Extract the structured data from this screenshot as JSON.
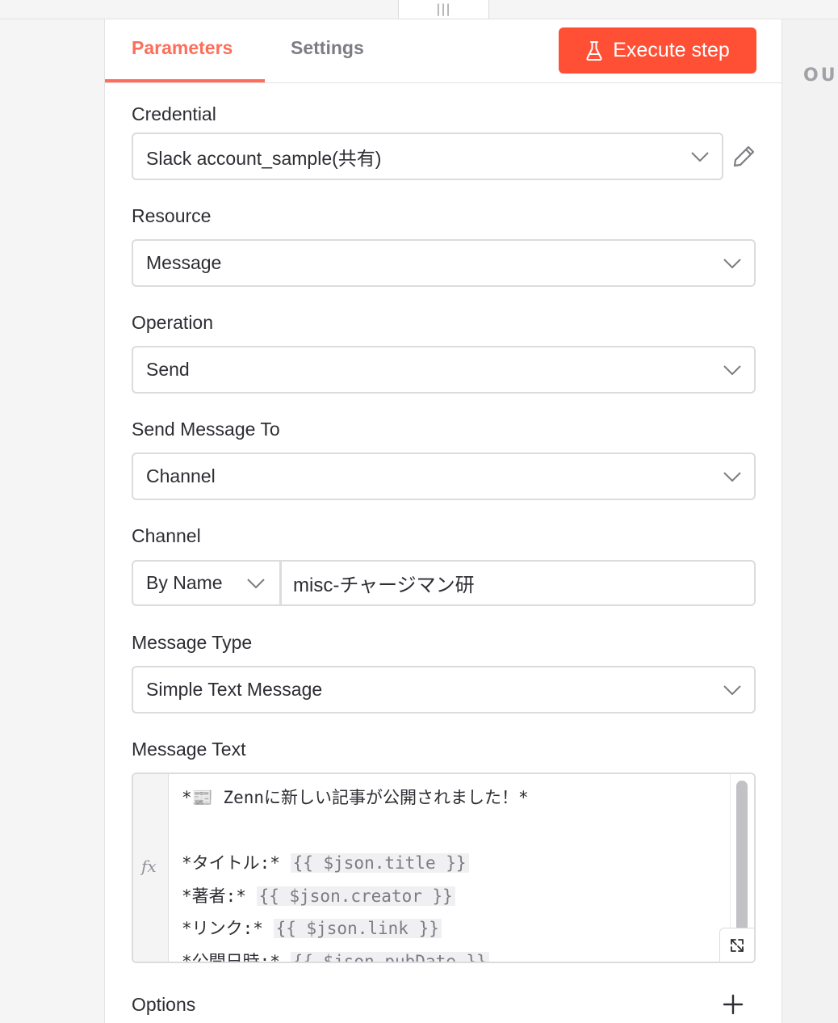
{
  "drag_handle": {
    "glyph": "|||"
  },
  "right_panel": {
    "label": "OU"
  },
  "tabs": [
    {
      "label": "Parameters",
      "active": true
    },
    {
      "label": "Settings",
      "active": false
    }
  ],
  "execute_button": {
    "label": "Execute step",
    "icon": "flask-icon"
  },
  "colors": {
    "accent": "#ff6d5a",
    "button": "#ff5036",
    "border": "#dcdcdf",
    "text": "#2d2d33"
  },
  "fields": {
    "credential": {
      "label": "Credential",
      "value": "Slack account_sample(共有)",
      "edit_icon": "pencil-icon"
    },
    "resource": {
      "label": "Resource",
      "value": "Message"
    },
    "operation": {
      "label": "Operation",
      "value": "Send"
    },
    "send_to": {
      "label": "Send Message To",
      "value": "Channel"
    },
    "channel": {
      "label": "Channel",
      "mode": "By Name",
      "value": "misc-チャージマン研"
    },
    "message_type": {
      "label": "Message Type",
      "value": "Simple Text Message"
    },
    "message_text": {
      "label": "Message Text",
      "fx": "fx",
      "lines": [
        {
          "text": "*📰 Zennに新しい記事が公開されました！*",
          "expr": ""
        },
        {
          "text": "",
          "expr": ""
        },
        {
          "text": "*タイトル:* ",
          "expr": "{{ $json.title }}"
        },
        {
          "text": "*著者:* ",
          "expr": "{{ $json.creator }}"
        },
        {
          "text": "*リンク:* ",
          "expr": "{{ $json.link }}"
        },
        {
          "text": "*公開日時:* ",
          "expr": "{{ $json.pubDate }}"
        }
      ]
    },
    "options": {
      "label": "Options",
      "add_icon": "plus-icon"
    }
  }
}
